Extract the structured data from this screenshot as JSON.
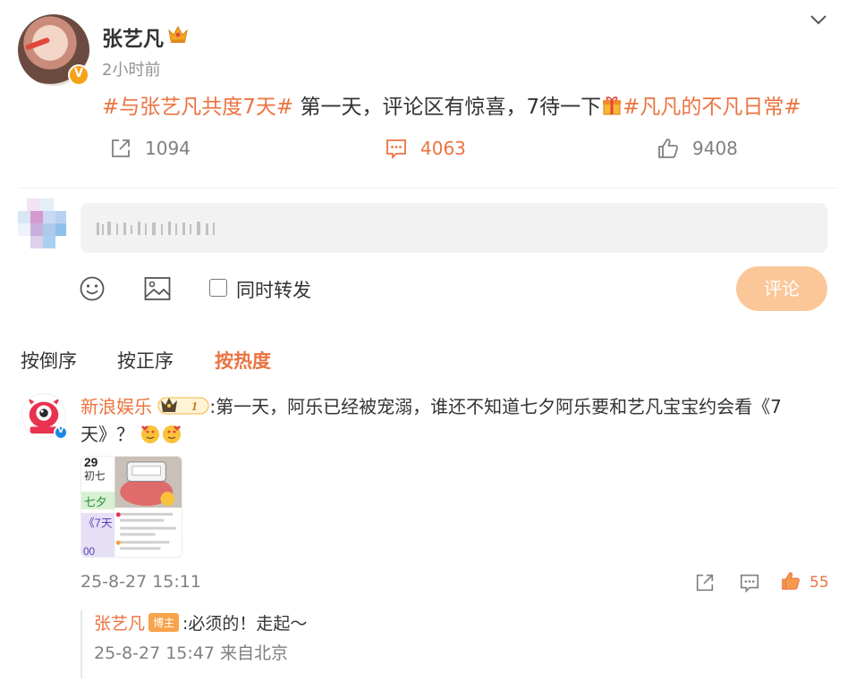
{
  "post": {
    "author": "张艺凡",
    "time": "2小时前",
    "hashtag1": "#与张艺凡共度7天#",
    "text_part1": " 第一天，评论区有惊喜，7待一下",
    "hashtag2": "#凡凡的不凡日常#",
    "forward_count": "1094",
    "comment_count": "4063",
    "like_count": "9408"
  },
  "composer": {
    "placeholder": "",
    "sync_label": "同时转发",
    "submit_label": "评论"
  },
  "sort": {
    "options": [
      "按倒序",
      "按正序",
      "按热度"
    ],
    "active": "按热度"
  },
  "comment": {
    "name": "新浪娱乐",
    "text": ":第一天，阿乐已经被宠溺，谁还不知道七夕阿乐要和艺凡宝宝约会看《7天》？",
    "rank_level": "1",
    "date": "25-8-27 15:11",
    "like_count": "55",
    "image_texts": [
      "29",
      "初七",
      "七夕",
      "《7天",
      "00"
    ],
    "reply": {
      "name": "张艺凡",
      "badge": "博主",
      "text": ":必须的！走起～",
      "date": "25-8-27 15:47 来自北京"
    }
  },
  "colors": {
    "accent": "#eb7340",
    "submit_bg": "#fbc799",
    "muted": "#808080"
  }
}
